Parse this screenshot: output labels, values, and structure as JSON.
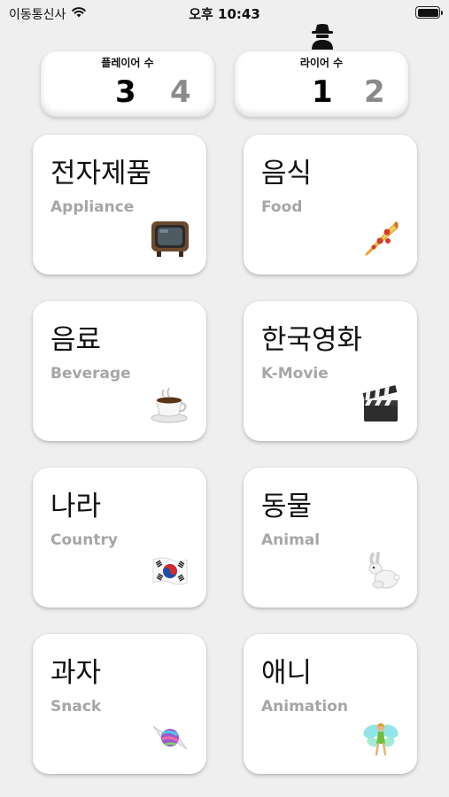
{
  "status_bar": {
    "carrier": "이동통신사",
    "time": "오후 10:43"
  },
  "counters": {
    "players": {
      "title": "플레이어 수",
      "current": "3",
      "next": "4"
    },
    "liars": {
      "title": "라이어 수",
      "current": "1",
      "next": "2"
    }
  },
  "categories": [
    {
      "title": "전자제품",
      "subtitle": "Appliance",
      "icon": "tv-icon"
    },
    {
      "title": "음식",
      "subtitle": "Food",
      "icon": "pizza-icon"
    },
    {
      "title": "음료",
      "subtitle": "Beverage",
      "icon": "coffee-icon"
    },
    {
      "title": "한국영화",
      "subtitle": "K-Movie",
      "icon": "clapperboard-icon"
    },
    {
      "title": "나라",
      "subtitle": "Country",
      "icon": "korea-flag-icon"
    },
    {
      "title": "동물",
      "subtitle": "Animal",
      "icon": "rabbit-icon"
    },
    {
      "title": "과자",
      "subtitle": "Snack",
      "icon": "candy-icon"
    },
    {
      "title": "애니",
      "subtitle": "Animation",
      "icon": "fairy-icon"
    }
  ]
}
